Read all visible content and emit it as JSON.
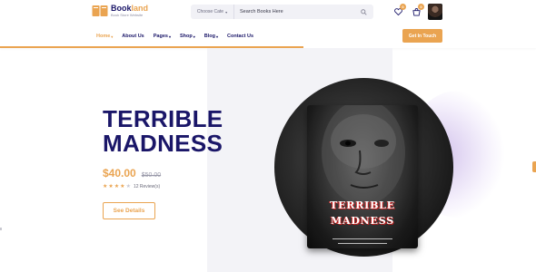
{
  "brand": {
    "name_part1": "Book",
    "name_part2": "land",
    "tagline": "Book Store Website"
  },
  "search": {
    "category_label": "Choose Cate",
    "placeholder": "Search Books Here"
  },
  "header": {
    "wishlist_count": "0",
    "cart_count": "0"
  },
  "nav": {
    "items": [
      {
        "label": "Home",
        "has_dropdown": true,
        "active": true
      },
      {
        "label": "About Us",
        "has_dropdown": false,
        "active": false
      },
      {
        "label": "Pages",
        "has_dropdown": true,
        "active": false
      },
      {
        "label": "Shop",
        "has_dropdown": true,
        "active": false
      },
      {
        "label": "Blog",
        "has_dropdown": true,
        "active": false
      },
      {
        "label": "Contact Us",
        "has_dropdown": false,
        "active": false
      }
    ],
    "cta_label": "Get In Touch"
  },
  "hero": {
    "title_line1": "TERRIBLE",
    "title_line2": "MADNESS",
    "price": "$40.00",
    "old_price": "$50.00",
    "rating": 4,
    "rating_max": 5,
    "reviews": "12 Review(s)",
    "details_label": "See Details"
  },
  "book_cover": {
    "title_line1": "TERRIBLE",
    "title_line2": "MADNESS"
  },
  "colors": {
    "accent": "#eaa451",
    "primary": "#1a1668",
    "hero_panel": "#f3f3f7"
  }
}
